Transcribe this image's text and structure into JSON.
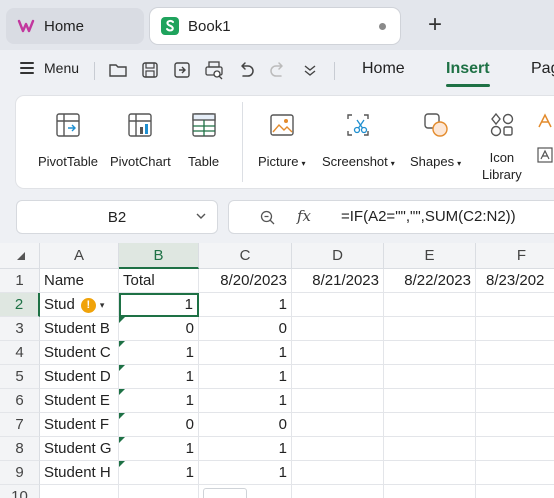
{
  "tabs": {
    "home_label": "Home",
    "book_label": "Book1"
  },
  "menubar": {
    "menu_label": "Menu",
    "ribbon_tabs": [
      "Home",
      "Insert",
      "Pag"
    ],
    "active_tab": "Insert"
  },
  "ribbon": {
    "pivottable": "PivotTable",
    "pivotchart": "PivotChart",
    "table": "Table",
    "picture": "Picture",
    "screenshot": "Screenshot",
    "shapes": "Shapes",
    "icon_library_1": "Icon",
    "icon_library_2": "Library"
  },
  "formula_bar": {
    "name_box": "B2",
    "fx_label": "fx",
    "formula": "=IF(A2=\"\",\"\",SUM(C2:N2))"
  },
  "sheet": {
    "columns": [
      "A",
      "B",
      "C",
      "D",
      "E",
      "F"
    ],
    "selected_column": "B",
    "selected_cell": "B2",
    "rows": [
      {
        "n": "1",
        "a": "Name",
        "b": "Total",
        "c": "8/20/2023",
        "d": "8/21/2023",
        "e": "8/22/2023",
        "f": "8/23/202"
      },
      {
        "n": "2",
        "a": "Stud",
        "b": "1",
        "c": "1"
      },
      {
        "n": "3",
        "a": "Student B",
        "b": "0",
        "c": "0"
      },
      {
        "n": "4",
        "a": "Student C",
        "b": "1",
        "c": "1"
      },
      {
        "n": "5",
        "a": "Student D",
        "b": "1",
        "c": "1"
      },
      {
        "n": "6",
        "a": "Student E",
        "b": "1",
        "c": "1"
      },
      {
        "n": "7",
        "a": "Student F",
        "b": "0",
        "c": "0"
      },
      {
        "n": "8",
        "a": "Student G",
        "b": "1",
        "c": "1"
      },
      {
        "n": "9",
        "a": "Student H",
        "b": "1",
        "c": "1"
      },
      {
        "n": "10"
      }
    ]
  },
  "colors": {
    "accent": "#1e7145",
    "warning": "#f0a30a"
  }
}
